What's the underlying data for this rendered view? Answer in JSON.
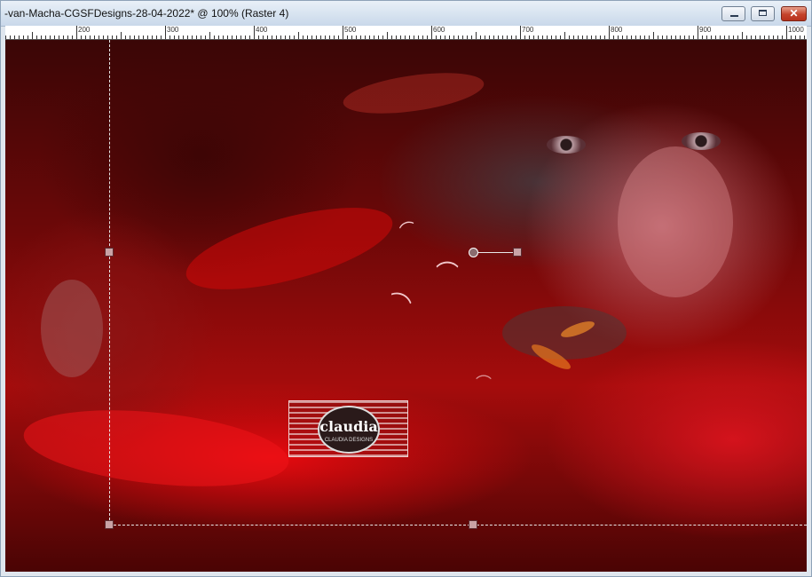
{
  "window": {
    "title": "-van-Macha-CGSFDesigns-28-04-2022* @ 100% (Raster 4)",
    "buttons": {
      "minimize": "minimize-icon",
      "maximize": "maximize-icon",
      "close": "close-icon"
    },
    "close_glyph": "✕"
  },
  "ruler": {
    "labels": [
      "200",
      "300",
      "400",
      "500",
      "600",
      "700",
      "800",
      "900",
      "1000"
    ]
  },
  "canvas": {
    "watermark_text": "claudia",
    "watermark_sub": "CLAUDIA DESIGNS",
    "accent_colors": {
      "deep_red": "#6b0808",
      "bright_red": "#e00a0f",
      "handle": "#c9a3a6"
    }
  }
}
